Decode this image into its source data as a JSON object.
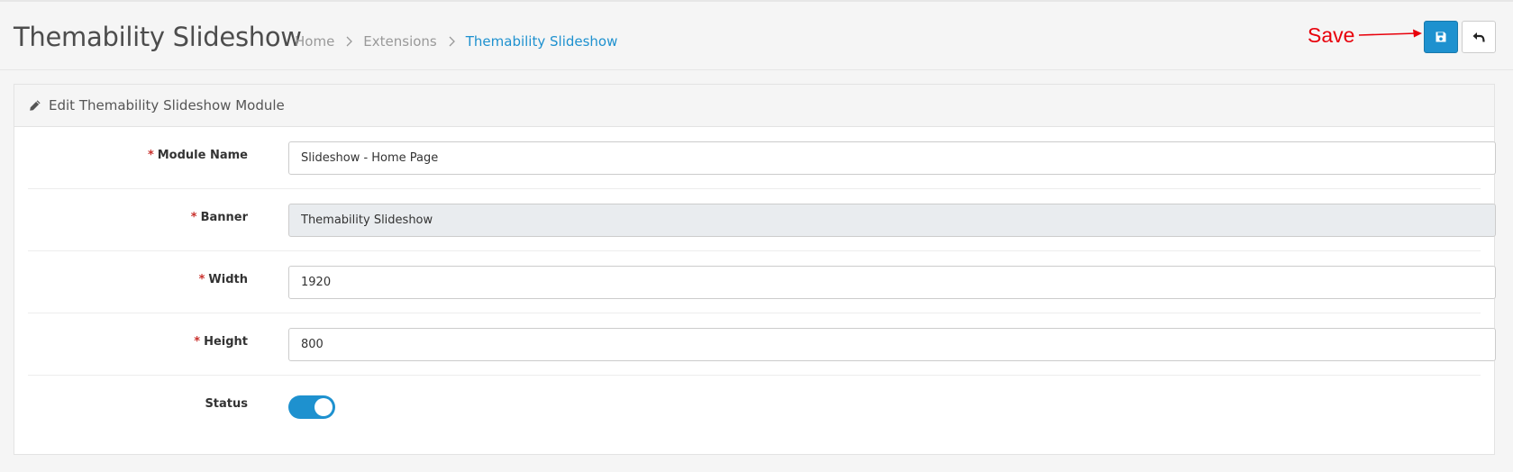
{
  "header": {
    "title": "Themability Slideshow",
    "breadcrumb": [
      "Home",
      "Extensions",
      "Themability Slideshow"
    ],
    "annotation": "Save",
    "save_icon": "save-icon",
    "back_icon": "reply-icon",
    "accent_color": "#1e91cf",
    "annotation_color": "#e8000b"
  },
  "panel": {
    "title": "Edit Themability Slideshow Module",
    "icon": "pencil-icon"
  },
  "form": {
    "required_mark": "*",
    "module_name": {
      "label": "Module Name",
      "value": "Slideshow - Home Page"
    },
    "banner": {
      "label": "Banner",
      "value": "Themability Slideshow"
    },
    "width": {
      "label": "Width",
      "value": "1920"
    },
    "height": {
      "label": "Height",
      "value": "800"
    },
    "status": {
      "label": "Status",
      "enabled": true
    }
  }
}
